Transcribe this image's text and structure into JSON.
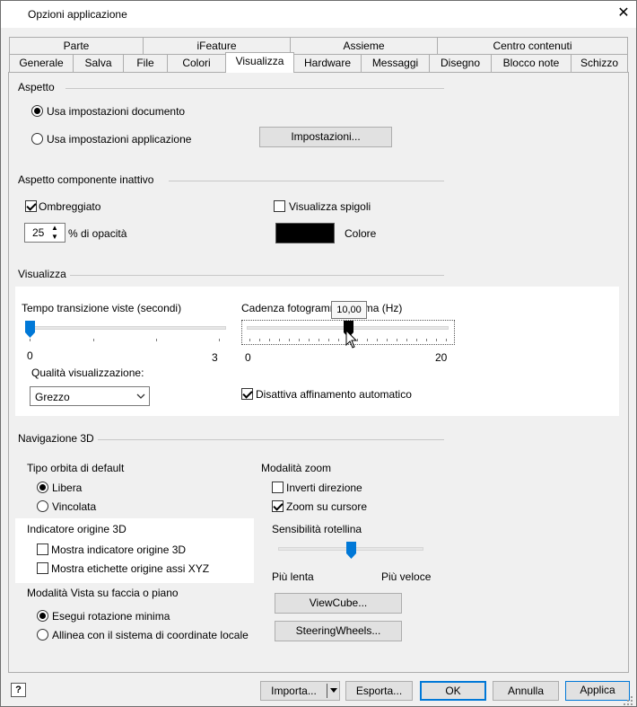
{
  "window": {
    "title": "Opzioni applicazione"
  },
  "tabs_row1": [
    "Parte",
    "iFeature",
    "Assieme",
    "Centro contenuti"
  ],
  "tabs_row2": [
    "Generale",
    "Salva",
    "File",
    "Colori",
    "Visualizza",
    "Hardware",
    "Messaggi",
    "Disegno",
    "Blocco note",
    "Schizzo"
  ],
  "selected_tab": "Visualizza",
  "aspetto": {
    "title": "Aspetto",
    "opt1": "Usa impostazioni documento",
    "opt2": "Usa impostazioni applicazione",
    "settings_btn": "Impostazioni..."
  },
  "inattivo": {
    "title": "Aspetto componente inattivo",
    "shaded": "Ombreggiato",
    "opacity_value": "25",
    "opacity_label": "% di opacità",
    "show_edges": "Visualizza spigoli",
    "color_label": "Colore",
    "color_swatch": "#000000"
  },
  "visualizza": {
    "title": "Visualizza",
    "transition_label": "Tempo transizione viste (secondi)",
    "transition_min": "0",
    "transition_max": "3",
    "transition_value": 0,
    "framerate_label": "Cadenza fotogrammi minima (Hz)",
    "framerate_min": "0",
    "framerate_max": "20",
    "framerate_value": 10,
    "framerate_tooltip": "10,00",
    "quality_label": "Qualità visualizzazione:",
    "quality_value": "Grezzo",
    "disable_refine": "Disattiva affinamento automatico"
  },
  "nav3d": {
    "title": "Navigazione 3D",
    "orbit_title": "Tipo orbita di default",
    "orbit_free": "Libera",
    "orbit_constrained": "Vincolata",
    "origin_title": "Indicatore origine 3D",
    "show_origin": "Mostra indicatore origine 3D",
    "show_labels": "Mostra etichette origine assi XYZ",
    "face_title": "Modalità Vista su faccia o piano",
    "min_rotation": "Esegui rotazione minima",
    "align_local": "Allinea con il sistema di coordinate locale",
    "zoom_title": "Modalità zoom",
    "invert_dir": "Inverti direzione",
    "zoom_cursor": "Zoom su cursore",
    "wheel_title": "Sensibilità rotellina",
    "wheel_slow": "Più lenta",
    "wheel_fast": "Più veloce",
    "wheel_value": 0.5,
    "viewcube_btn": "ViewCube...",
    "steering_btn": "SteeringWheels..."
  },
  "footer": {
    "help_icon": "help-icon",
    "import_btn": "Importa...",
    "export_btn": "Esporta...",
    "ok_btn": "OK",
    "cancel_btn": "Annulla",
    "apply_btn": "Applica"
  }
}
